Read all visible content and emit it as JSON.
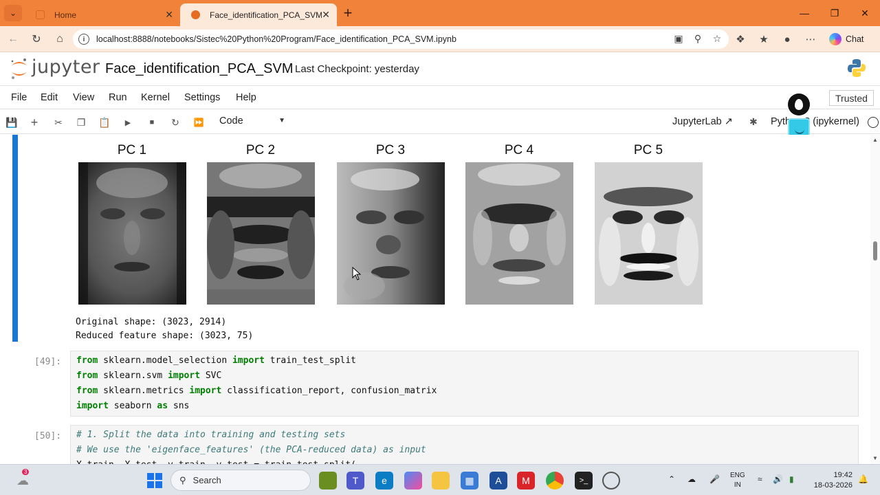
{
  "browser": {
    "tabs": [
      {
        "title": "Home",
        "active": false
      },
      {
        "title": "Face_identification_PCA_SVM",
        "active": true
      }
    ],
    "url": "localhost:8888/notebooks/Sistec%20Python%20Program/Face_identification_PCA_SVM.ipynb",
    "chat_label": "Chat"
  },
  "jupyter": {
    "logo_text": "jupyter",
    "notebook_title": "Face_identification_PCA_SVM",
    "checkpoint": "Last Checkpoint: yesterday",
    "menu": [
      "File",
      "Edit",
      "View",
      "Run",
      "Kernel",
      "Settings",
      "Help"
    ],
    "trusted": "Trusted",
    "cell_type": "Code",
    "jupyterlab_link": "JupyterLab",
    "kernel": "Python 3 (ipykernel)"
  },
  "output": {
    "pc_titles": [
      "PC 1",
      "PC 2",
      "PC 3",
      "PC 4",
      "PC 5"
    ],
    "original_shape": "Original shape: (3023, 2914)",
    "reduced_shape": "Reduced feature shape: (3023, 75)"
  },
  "cells": [
    {
      "prompt": "[49]:",
      "lines": [
        [
          [
            "kw",
            "from"
          ],
          [
            "",
            " sklearn.model_selection "
          ],
          [
            "kw",
            "import"
          ],
          [
            "",
            " train_test_split"
          ]
        ],
        [
          [
            "kw",
            "from"
          ],
          [
            "",
            " sklearn.svm "
          ],
          [
            "kw",
            "import"
          ],
          [
            "",
            " SVC"
          ]
        ],
        [
          [
            "kw",
            "from"
          ],
          [
            "",
            " sklearn.metrics "
          ],
          [
            "kw",
            "import"
          ],
          [
            "",
            " classification_report, confusion_matrix"
          ]
        ],
        [
          [
            "kw",
            "import"
          ],
          [
            "",
            " seaborn "
          ],
          [
            "kw",
            "as"
          ],
          [
            "",
            " sns"
          ]
        ]
      ]
    },
    {
      "prompt": "[50]:",
      "lines": [
        [
          [
            "cm",
            "# 1. Split the data into training and testing sets"
          ]
        ],
        [
          [
            "cm",
            "# We use the 'eigenface_features' (the PCA-reduced data) as input"
          ]
        ],
        [
          [
            "",
            "X_train, X_test, y_train, y_test = train_test_split("
          ]
        ]
      ]
    }
  ],
  "taskbar": {
    "search_placeholder": "Search",
    "notification_count": "3",
    "lang_line1": "ENG",
    "lang_line2": "IN",
    "time": "19:42",
    "date": "18-03-2026"
  }
}
